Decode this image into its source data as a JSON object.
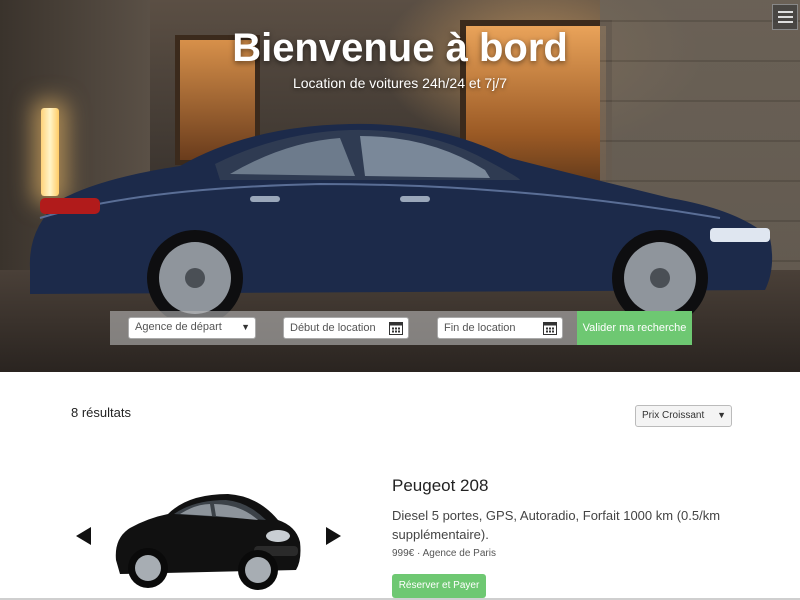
{
  "hero": {
    "title": "Bienvenue à bord",
    "subtitle": "Location de voitures 24h/24 et 7j/7"
  },
  "search": {
    "agency_label": "Agence de départ",
    "start_placeholder": "Début de location",
    "end_placeholder": "Fin de location",
    "submit_label": "Valider ma recherche"
  },
  "results": {
    "count_label": "8 résultats",
    "sort_selected": "Prix Croissant"
  },
  "car": {
    "name": "Peugeot 208",
    "description": "Diesel 5 portes, GPS, Autoradio, Forfait 1000 km (0.5/km supplémentaire).",
    "meta": "999€ · Agence de Paris",
    "book_label": "Réserver et Payer"
  },
  "colors": {
    "accent_green": "#6ec872",
    "hero_car": "#1c2a4a",
    "thumb_car": "#111111"
  },
  "icons": [
    "menu-icon",
    "calendar-icon",
    "chevron-down-icon",
    "arrow-left-icon",
    "arrow-right-icon"
  ]
}
